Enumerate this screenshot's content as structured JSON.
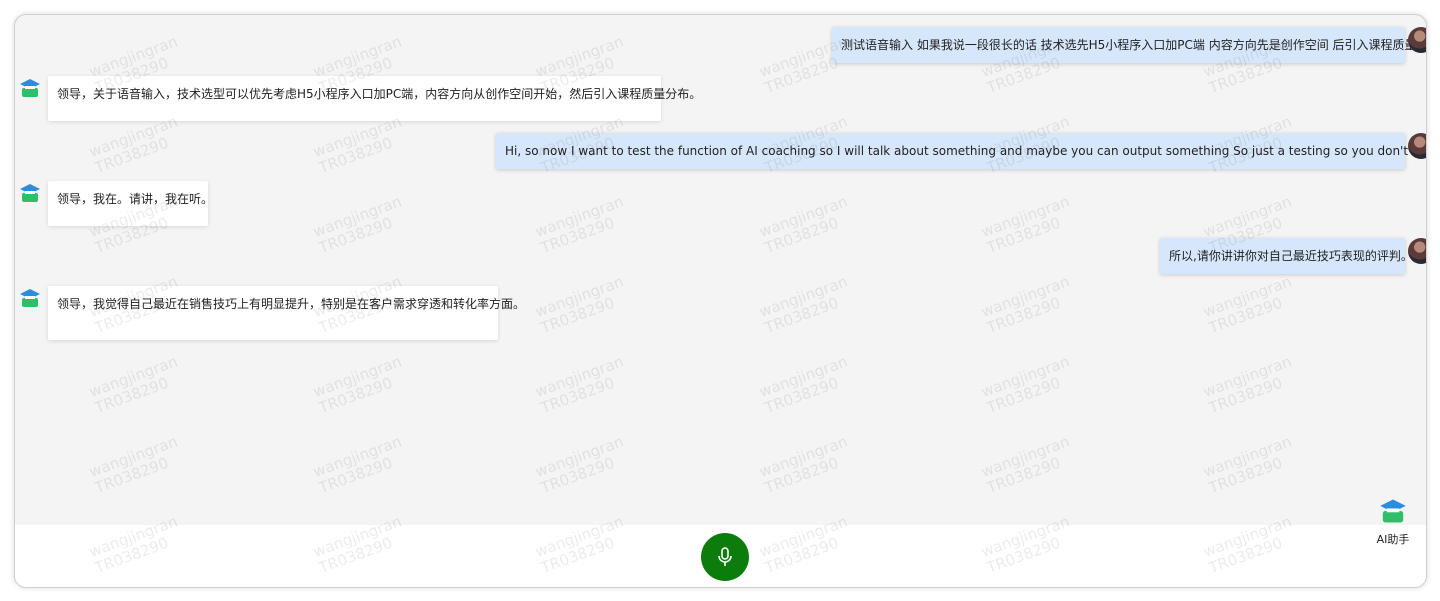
{
  "messages": [
    {
      "role": "user",
      "text": "测试语音输入 如果我说一段很长的话 技术选先H5小程序入口加PC端 内容方向先是创作空间 后引入课程质量分布"
    },
    {
      "role": "ai",
      "text": "领导，关于语音输入，技术选型可以优先考虑H5小程序入口加PC端，内容方向从创作空间开始，然后引入课程质量分布。"
    },
    {
      "role": "user",
      "text": "Hi, so now I want to test the function of AI coaching so I will talk about something and maybe you can output something So just a testing so you don't care what the content is"
    },
    {
      "role": "ai",
      "text": "领导，我在。请讲，我在听。"
    },
    {
      "role": "user",
      "text": "所以,请你讲讲你对自己最近技巧表现的评判。"
    },
    {
      "role": "ai",
      "text": "领导，我觉得自己最近在销售技巧上有明显提升，特别是在客户需求穿透和转化率方面。"
    }
  ],
  "watermark": {
    "line1": "wangjingran",
    "line2": "TR038290"
  },
  "assistant": {
    "label": "AI助手"
  },
  "icons": {
    "mic": "microphone-icon",
    "ai": "graduation-cap-icon",
    "user": "user-avatar"
  },
  "colors": {
    "mic_button": "#0c7c0c",
    "user_bubble": "#d7e7fb",
    "ai_bubble": "#ffffff",
    "background": "#f4f4f4"
  }
}
